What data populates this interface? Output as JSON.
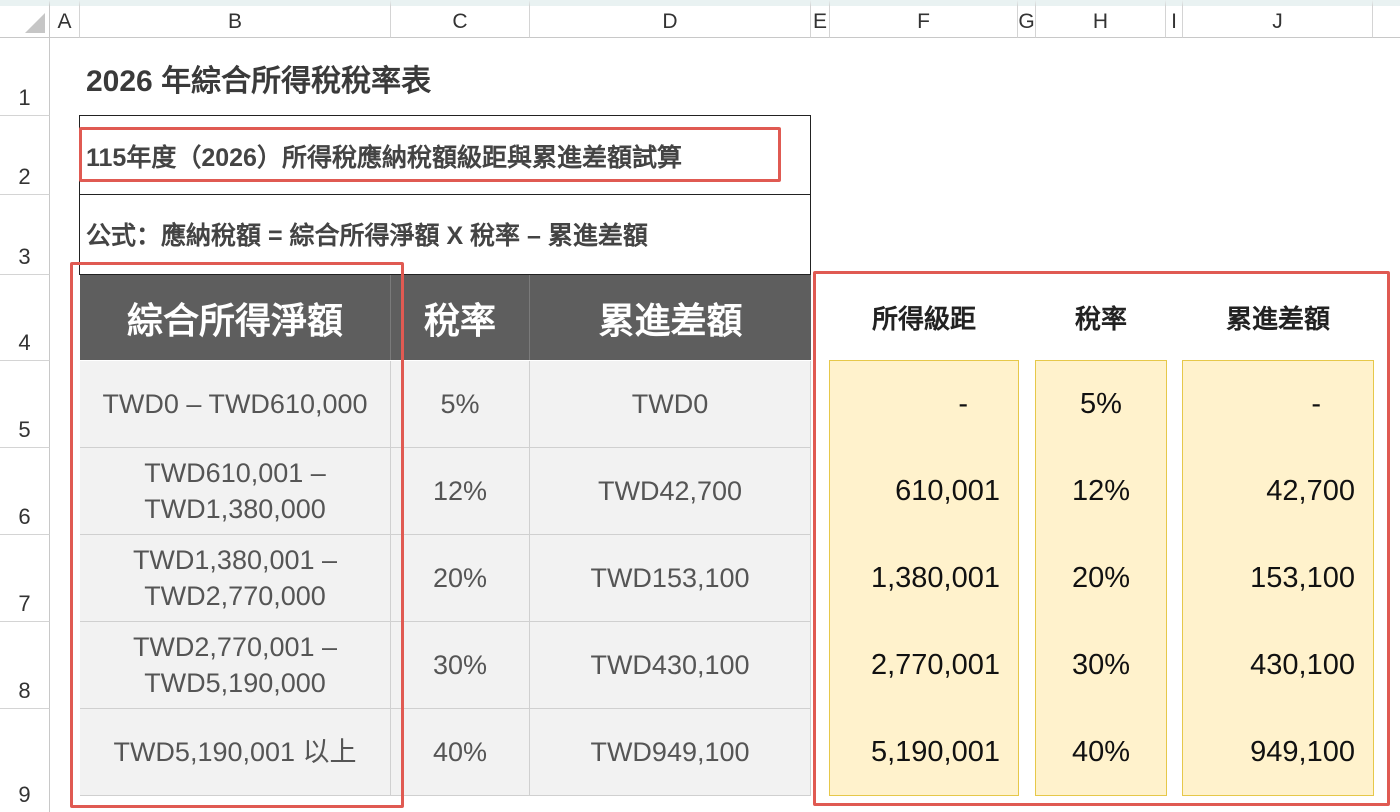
{
  "columns": [
    "A",
    "B",
    "C",
    "D",
    "E",
    "F",
    "G",
    "H",
    "I",
    "J"
  ],
  "rows": [
    "1",
    "2",
    "3",
    "4",
    "5",
    "6",
    "7",
    "8",
    "9"
  ],
  "sheet": {
    "title": "2026 年綜合所得稅稅率表",
    "subtitle": "115年度（2026）所得稅應納稅額級距與累進差額試算",
    "formula": "公式：應納稅額 = 綜合所得淨額 X 稅率 – 累進差額"
  },
  "left_table": {
    "headers": [
      "綜合所得淨額",
      "稅率",
      "累進差額"
    ],
    "rows": [
      {
        "range": "TWD0 – TWD610,000",
        "rate": "5%",
        "diff": "TWD0"
      },
      {
        "range": "TWD610,001 –\nTWD1,380,000",
        "rate": "12%",
        "diff": "TWD42,700"
      },
      {
        "range": "TWD1,380,001 –\nTWD2,770,000",
        "rate": "20%",
        "diff": "TWD153,100"
      },
      {
        "range": "TWD2,770,001 –\nTWD5,190,000",
        "rate": "30%",
        "diff": "TWD430,100"
      },
      {
        "range": "TWD5,190,001 以上",
        "rate": "40%",
        "diff": "TWD949,100"
      }
    ]
  },
  "right_table": {
    "headers": [
      "所得級距",
      "稅率",
      "累進差額"
    ],
    "rows": [
      {
        "bracket": "-",
        "rate": "5%",
        "diff": "-"
      },
      {
        "bracket": "610,001",
        "rate": "12%",
        "diff": "42,700"
      },
      {
        "bracket": "1,380,001",
        "rate": "20%",
        "diff": "153,100"
      },
      {
        "bracket": "2,770,001",
        "rate": "30%",
        "diff": "430,100"
      },
      {
        "bracket": "5,190,001",
        "rate": "40%",
        "diff": "949,100"
      }
    ]
  },
  "colors": {
    "header_bg": "#5e5e5e",
    "cell_bg": "#f2f2f2",
    "yellow_bg": "#fff2cc",
    "yellow_border": "#e6c84a",
    "highlight": "#e05a52"
  }
}
